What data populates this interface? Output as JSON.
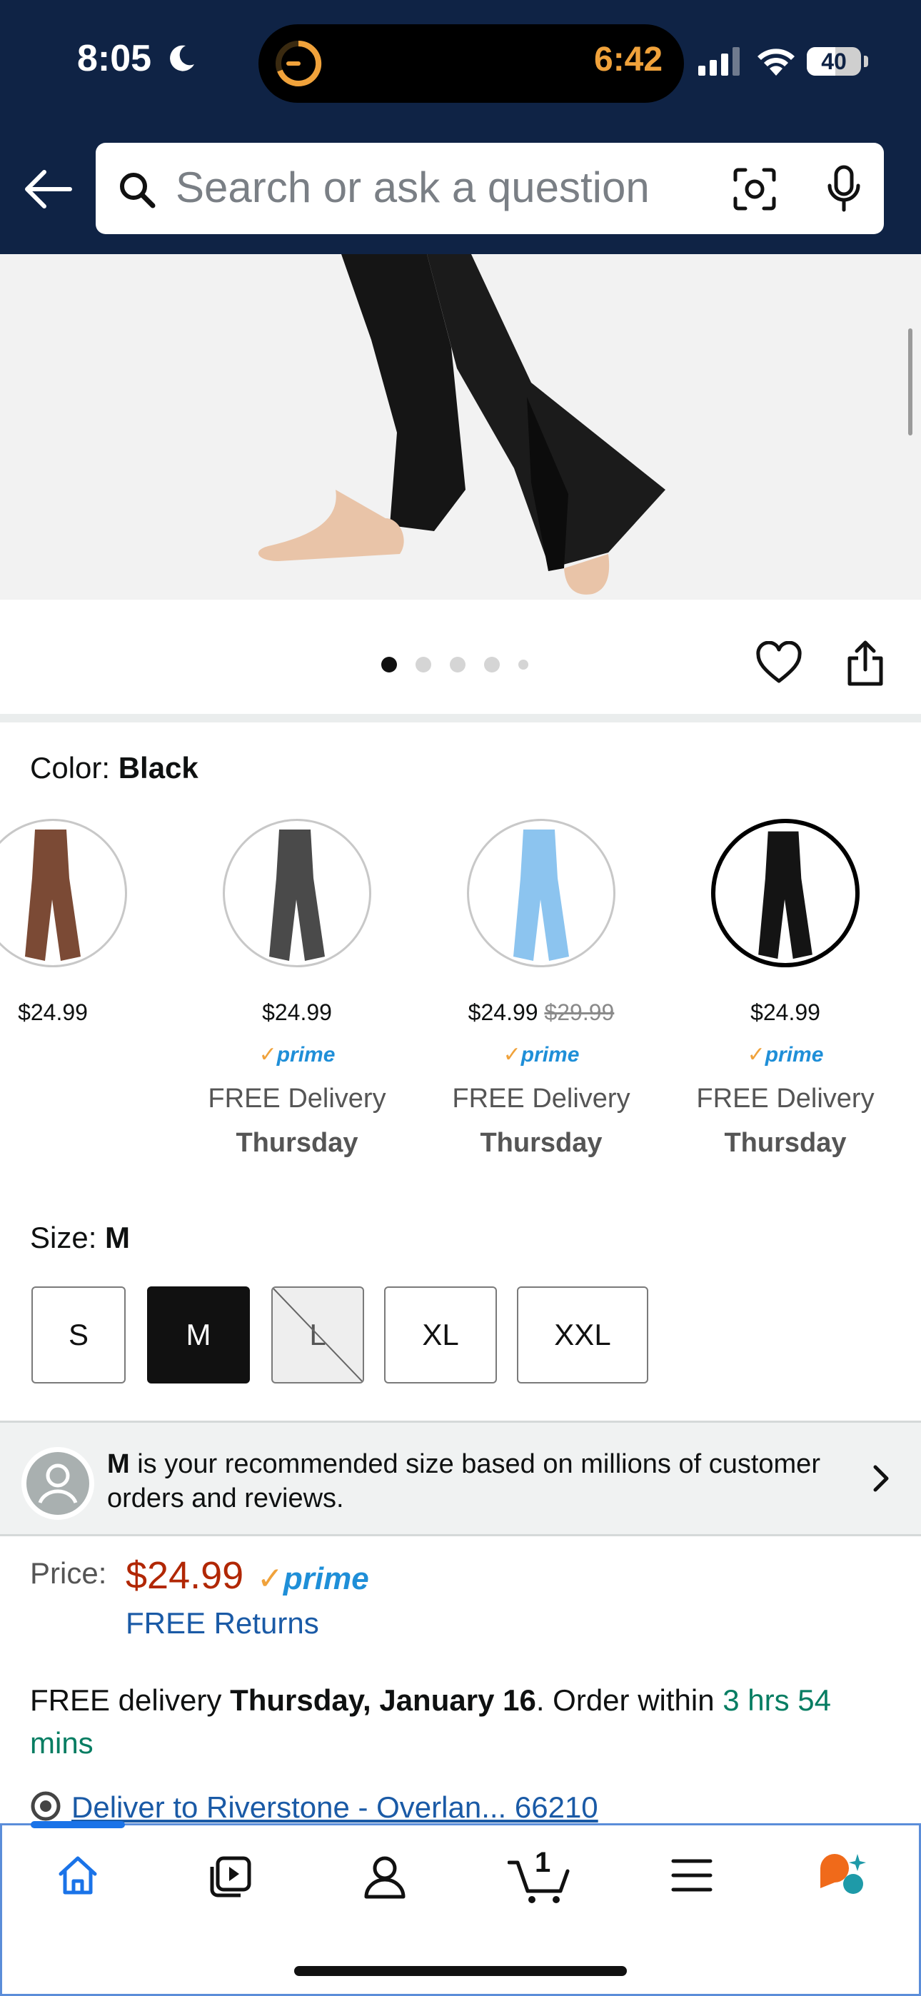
{
  "status": {
    "time": "8:05",
    "island_time": "6:42",
    "battery": "40"
  },
  "header": {
    "search_placeholder": "Search or ask a question"
  },
  "color": {
    "label": "Color: ",
    "value": "Black"
  },
  "swatches": [
    {
      "price": "$24.99",
      "strike": "",
      "prime": "",
      "free": "",
      "day": "",
      "fill": "#7b4a35"
    },
    {
      "price": "$24.99",
      "strike": "",
      "prime": "prime",
      "free": "FREE Delivery",
      "day": "Thursday",
      "fill": "#4a4a4a"
    },
    {
      "price": "$24.99",
      "strike": "$29.99",
      "prime": "prime",
      "free": "FREE Delivery",
      "day": "Thursday",
      "fill": "#8cc4ef"
    },
    {
      "price": "$24.99",
      "strike": "",
      "prime": "prime",
      "free": "FREE Delivery",
      "day": "Thursday",
      "fill": "#141414"
    }
  ],
  "size": {
    "label": "Size: ",
    "value": "M",
    "options": [
      "S",
      "M",
      "L",
      "XL",
      "XXL"
    ]
  },
  "recommendation": {
    "bold": "M",
    "text": " is your recommended size based on millions of customer orders and reviews."
  },
  "price": {
    "label": "Price:",
    "value": "$24.99",
    "prime": "prime",
    "returns": "FREE Returns"
  },
  "delivery": {
    "prefix": "FREE delivery ",
    "date": "Thursday, January 16",
    "mid": ". Order within ",
    "countdown": "3 hrs 54 mins"
  },
  "deliver_to": "Deliver to Riverstone - Overlan... 66210",
  "nav": {
    "cart_count": "1"
  },
  "colors": {
    "header_bg": "#0f2345",
    "price_red": "#b12704",
    "link_blue": "#1a5aa6",
    "prime_blue": "#1f8fd8",
    "green": "#067d62"
  }
}
